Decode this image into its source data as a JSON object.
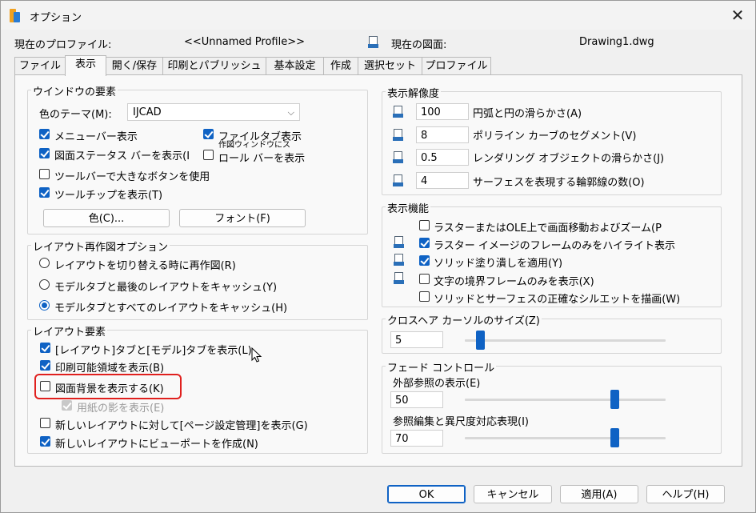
{
  "window": {
    "title": "オプション",
    "close_glyph": "✕"
  },
  "header": {
    "profile_label": "現在のプロファイル:",
    "profile_value": "<<Unnamed Profile>>",
    "drawing_label": "現在の図面:",
    "drawing_value": "Drawing1.dwg"
  },
  "tabs": [
    "ファイル",
    "表示",
    "開く/保存",
    "印刷とパブリッシュ",
    "基本設定",
    "作成",
    "選択セット",
    "プロファイル"
  ],
  "active_tab": "表示",
  "window_elements": {
    "title": "ウインドウの要素",
    "theme_label": "色のテーマ(M):",
    "theme_value": "IJCAD",
    "checkboxes": [
      {
        "label": "メニューバー表示",
        "checked": true
      },
      {
        "label": "ファイルタブ表示",
        "checked": true
      },
      {
        "label": "図面ステータス バーを表示(I",
        "checked": true
      },
      {
        "label": "ロール バーを表示",
        "checked": false
      },
      {
        "label": "ツールバーで大きなボタンを使用",
        "checked": false
      },
      {
        "label": "ツールチップを表示(T)",
        "checked": true
      }
    ],
    "overlap_text": "作図ウィンドウにス",
    "color_button": "色(C)...",
    "font_button": "フォント(F)"
  },
  "layout_regen": {
    "title": "レイアウト再作図オプション",
    "radios": [
      {
        "label": "レイアウトを切り替える時に再作図(R)",
        "selected": false
      },
      {
        "label": "モデルタブと最後のレイアウトをキャッシュ(Y)",
        "selected": false
      },
      {
        "label": "モデルタブとすべてのレイアウトをキャッシュ(H)",
        "selected": true
      }
    ]
  },
  "layout_elements": {
    "title": "レイアウト要素",
    "checkboxes": [
      {
        "label": "[レイアウト]タブと[モデル]タブを表示(L)",
        "checked": true,
        "disabled": false
      },
      {
        "label": "印刷可能領域を表示(B)",
        "checked": true,
        "disabled": false
      },
      {
        "label": "図面背景を表示する(K)",
        "checked": false,
        "disabled": false
      },
      {
        "label": "用紙の影を表示(E)",
        "checked": true,
        "disabled": true
      },
      {
        "label": "新しいレイアウトに対して[ページ設定管理]を表示(G)",
        "checked": false,
        "disabled": false
      },
      {
        "label": "新しいレイアウトにビューポートを作成(N)",
        "checked": true,
        "disabled": false
      }
    ]
  },
  "display_resolution": {
    "title": "表示解像度",
    "rows": [
      {
        "value": "100",
        "label": "円弧と円の滑らかさ(A)"
      },
      {
        "value": "8",
        "label": "ポリライン カーブのセグメント(V)"
      },
      {
        "value": "0.5",
        "label": "レンダリング オブジェクトの滑らかさ(J)"
      },
      {
        "value": "4",
        "label": "サーフェスを表現する輪郭線の数(O)"
      }
    ]
  },
  "display_performance": {
    "title": "表示機能",
    "checkboxes": [
      {
        "label": "ラスターまたはOLE上で画面移動およびズーム(P",
        "checked": false,
        "icon": false
      },
      {
        "label": "ラスター イメージのフレームのみをハイライト表示",
        "checked": true,
        "icon": true
      },
      {
        "label": "ソリッド塗り潰しを適用(Y)",
        "checked": true,
        "icon": true
      },
      {
        "label": "文字の境界フレームのみを表示(X)",
        "checked": false,
        "icon": true
      },
      {
        "label": "ソリッドとサーフェスの正確なシルエットを描画(W)",
        "checked": false,
        "icon": false
      }
    ]
  },
  "crosshair": {
    "title": "クロスヘア カーソルのサイズ(Z)",
    "value": "5",
    "fraction": 0.05
  },
  "fade": {
    "title": "フェード コントロール",
    "xref_label": "外部参照の表示(E)",
    "xref_value": "50",
    "xref_fraction": 0.75,
    "inplace_label": "参照編集と異尺度対応表現(I)",
    "inplace_value": "70",
    "inplace_fraction": 0.75
  },
  "footer": {
    "ok": "OK",
    "cancel": "キャンセル",
    "apply": "適用(A)",
    "help": "ヘルプ(H)"
  }
}
